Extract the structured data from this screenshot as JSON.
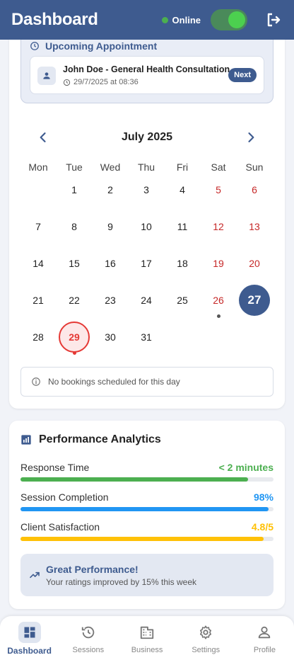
{
  "header": {
    "title": "Dashboard",
    "status_label": "Online",
    "status_color": "#4caf50",
    "online_toggle": true
  },
  "appointment": {
    "section_title": "Upcoming Appointment",
    "name": "John Doe - General Health Consultation",
    "datetime": "29/7/2025 at 08:36",
    "badge": "Next"
  },
  "calendar": {
    "month_label": "July 2025",
    "weekdays": [
      "Mon",
      "Tue",
      "Wed",
      "Thu",
      "Fri",
      "Sat",
      "Sun"
    ],
    "days": [
      "1",
      "2",
      "3",
      "4",
      "5",
      "6",
      "7",
      "8",
      "9",
      "10",
      "11",
      "12",
      "13",
      "14",
      "15",
      "16",
      "17",
      "18",
      "19",
      "20",
      "21",
      "22",
      "23",
      "24",
      "25",
      "26",
      "27",
      "28",
      "29",
      "30",
      "31"
    ],
    "today": "27",
    "selected": "29",
    "event_days": [
      "26",
      "29"
    ],
    "no_bookings_text": "No bookings scheduled for this day"
  },
  "performance": {
    "title": "Performance Analytics",
    "metrics": [
      {
        "label": "Response Time",
        "value": "< 2 minutes",
        "fraction": 0.9,
        "color": "#4caf50"
      },
      {
        "label": "Session Completion",
        "value": "98%",
        "fraction": 0.98,
        "color": "#2196f3"
      },
      {
        "label": "Client Satisfaction",
        "value": "4.8/5",
        "fraction": 0.96,
        "color": "#ffc107"
      }
    ],
    "banner_title": "Great Performance!",
    "banner_text": "Your ratings improved by 15% this week"
  },
  "nav": [
    {
      "label": "Dashboard",
      "icon": "dashboard-icon",
      "active": true
    },
    {
      "label": "Sessions",
      "icon": "history-icon",
      "active": false
    },
    {
      "label": "Business",
      "icon": "building-icon",
      "active": false
    },
    {
      "label": "Settings",
      "icon": "gear-icon",
      "active": false
    },
    {
      "label": "Profile",
      "icon": "person-icon",
      "active": false
    }
  ]
}
